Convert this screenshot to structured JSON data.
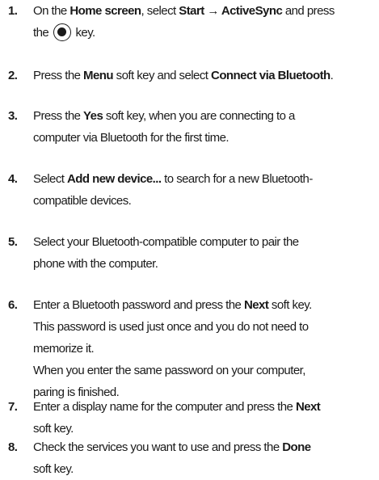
{
  "steps": [
    {
      "number": "1.",
      "lines": [
        [
          {
            "t": "On the "
          },
          {
            "t": "Home screen",
            "b": true
          },
          {
            "t": ", select "
          },
          {
            "t": "Start",
            "b": true
          },
          {
            "t": " → ",
            "b": true
          },
          {
            "t": "ActiveSync",
            "b": true
          },
          {
            "t": " and press"
          }
        ],
        [
          {
            "t": "the "
          },
          {
            "icon": "center-key-icon"
          },
          {
            "t": " key."
          }
        ]
      ]
    },
    {
      "number": "2.",
      "lines": [
        [
          {
            "t": "Press the "
          },
          {
            "t": "Menu",
            "b": true
          },
          {
            "t": " soft key and select "
          },
          {
            "t": "Connect via Bluetooth",
            "b": true
          },
          {
            "t": "."
          }
        ]
      ]
    },
    {
      "number": "3.",
      "lines": [
        [
          {
            "t": "Press the "
          },
          {
            "t": "Yes",
            "b": true
          },
          {
            "t": " soft key, when you are connecting to a"
          }
        ],
        [
          {
            "t": "computer via Bluetooth for the first time."
          }
        ]
      ]
    },
    {
      "number": "4.",
      "lines": [
        [
          {
            "t": "Select "
          },
          {
            "t": "Add new device...",
            "b": true
          },
          {
            "t": " to search for a new Bluetooth-"
          }
        ],
        [
          {
            "t": "compatible devices."
          }
        ]
      ]
    },
    {
      "number": "5.",
      "lines": [
        [
          {
            "t": "Select your Bluetooth-compatible computer to pair the"
          }
        ],
        [
          {
            "t": "phone with the computer."
          }
        ]
      ]
    },
    {
      "number": "6.",
      "lines": [
        [
          {
            "t": "Enter a Bluetooth password and press the "
          },
          {
            "t": "Next",
            "b": true
          },
          {
            "t": " soft key."
          }
        ],
        [
          {
            "t": "This password is used just once and you do not need to"
          }
        ],
        [
          {
            "t": "memorize it."
          }
        ],
        [
          {
            "t": "When you enter the same password on your computer,"
          }
        ],
        [
          {
            "t": "paring is finished."
          }
        ]
      ]
    },
    {
      "number": "7.",
      "lines": [
        [
          {
            "t": "Enter a display name for the computer and press the "
          },
          {
            "t": "Next",
            "b": true
          }
        ],
        [
          {
            "t": "soft key."
          }
        ]
      ]
    },
    {
      "number": "8.",
      "lines": [
        [
          {
            "t": "Check the services you want to use and press the "
          },
          {
            "t": "Done",
            "b": true
          }
        ],
        [
          {
            "t": "soft key."
          }
        ]
      ]
    }
  ]
}
